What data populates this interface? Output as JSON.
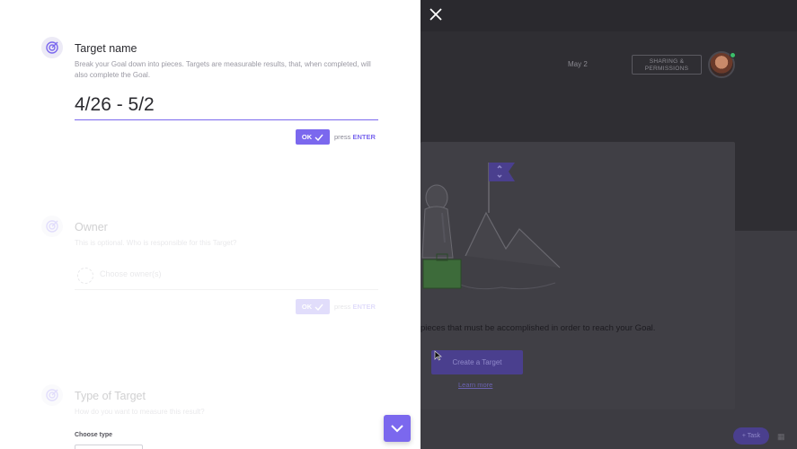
{
  "background": {
    "date": "May 2",
    "sharing": {
      "line1": "SHARING &",
      "line2": "PERMISSIONS"
    },
    "description": "pieces that must be accomplished in order to reach your Goal.",
    "create_target": "Create a Target",
    "learn_more": "Learn more",
    "task_button": "+ Task"
  },
  "panel": {
    "target_name": {
      "title": "Target name",
      "description": "Break your Goal down into pieces. Targets are measurable results, that, when completed, will also complete the Goal.",
      "value": "4/26 - 5/2",
      "ok_label": "OK",
      "press": "press",
      "enter": "ENTER"
    },
    "owner": {
      "title": "Owner",
      "description": "This is optional. Who is responsible for this Target?",
      "placeholder": "Choose owner(s)",
      "ok_label": "OK",
      "press": "press",
      "enter": "ENTER"
    },
    "type_of_target": {
      "title": "Type of Target",
      "description": "How do you want to measure this result?",
      "choose_type": "Choose type"
    }
  },
  "colors": {
    "accent": "#7b68ee",
    "overlay": "#2f2e33"
  },
  "icons": {
    "close": "close-icon",
    "target": "target-icon",
    "scroll_down": "chevron-down-icon"
  }
}
